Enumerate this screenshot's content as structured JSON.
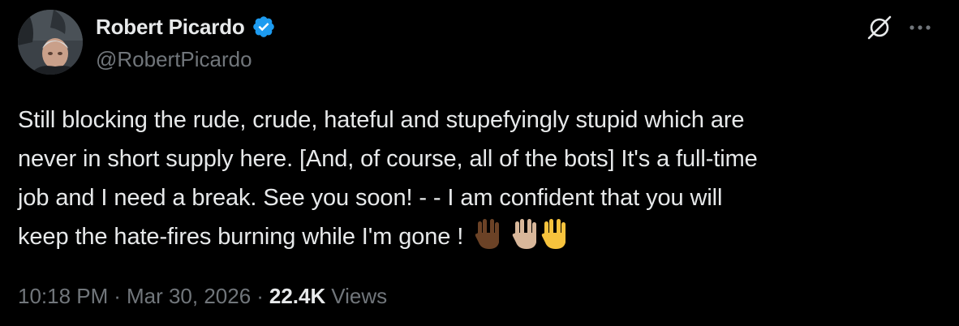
{
  "author": {
    "display_name": "Robert Picardo",
    "handle": "@RobertPicardo",
    "verified": true
  },
  "tweet": {
    "lines": [
      "Still blocking the rude, crude, hateful and stupefyingly stupid which are",
      "never in short supply here. [And, of course, all of the bots] It's a full-time",
      "job and I need a break. See you soon! - - I am confident that you will",
      "keep the hate-fires burning while I'm gone !"
    ],
    "emojis": [
      "vulcan-salute-dark-skin",
      "vulcan-salute-medium-light-skin",
      "vulcan-salute-default"
    ]
  },
  "meta": {
    "time": "10:18 PM",
    "separator": "·",
    "date": "Mar 30, 2026",
    "views_count": "22.4K",
    "views_label": "Views"
  },
  "icons": {
    "grok": "grok-icon",
    "more": "more-icon",
    "verified": "verified-badge-icon"
  },
  "colors": {
    "background": "#000000",
    "primary_text": "#e7e9ea",
    "secondary_text": "#71767b",
    "verified_blue": "#1d9bf0"
  }
}
